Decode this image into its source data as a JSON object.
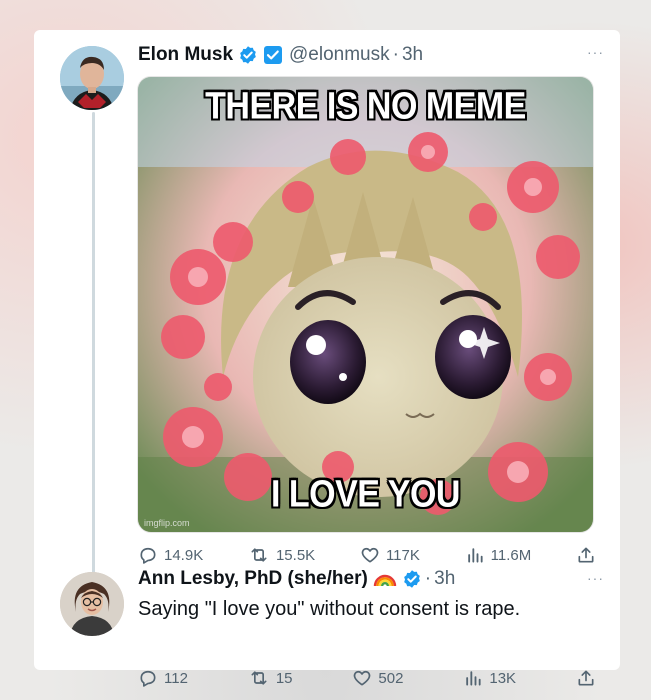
{
  "tweet": {
    "author_name": "Elon Musk",
    "handle": "@elonmusk",
    "separator": "·",
    "time": "3h",
    "more": "···",
    "meme": {
      "top_text": "THERE IS NO MEME",
      "bottom_text": "I LOVE YOU",
      "watermark": "imgflip.com"
    },
    "stats": {
      "replies": "14.9K",
      "retweets": "15.5K",
      "likes": "117K",
      "views": "11.6M"
    }
  },
  "reply": {
    "author_name": "Ann Lesby, PhD (she/her)",
    "separator": "·",
    "time": "3h",
    "more": "···",
    "text": "Saying \"I love you\" without consent is rape.",
    "stats": {
      "replies": "112",
      "retweets": "15",
      "likes": "502",
      "views": "13K"
    }
  },
  "colors": {
    "verified_blue": "#1d9bf0",
    "muted_text": "#536471",
    "primary_text": "#0f1419"
  }
}
